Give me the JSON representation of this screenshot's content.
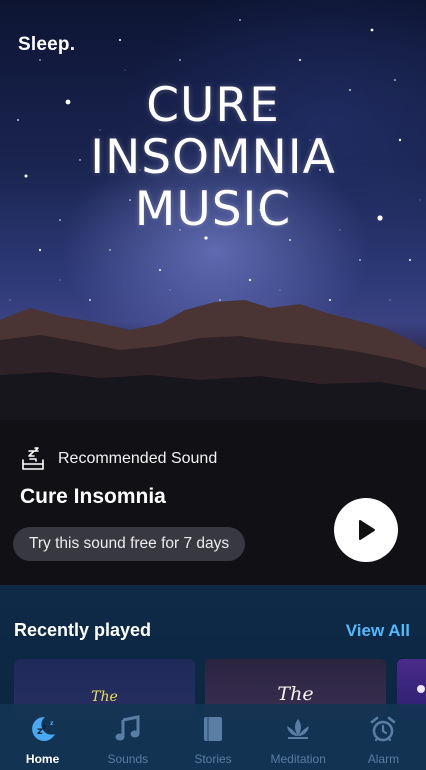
{
  "hero": {
    "brand": "Sleep.",
    "title_lines": [
      "CURE",
      "INSOMNIA",
      "MUSIC"
    ],
    "recommended_label": "Recommended Sound",
    "sound_title": "Cure Insomnia",
    "trial_text": "Try this sound free for 7 days"
  },
  "recent": {
    "header": "Recently played",
    "view_all": "View All",
    "cards": [
      {
        "text": "The"
      },
      {
        "text": "The"
      },
      {
        "text": ""
      }
    ]
  },
  "tabs": [
    {
      "label": "Home",
      "icon": "home-moon-icon",
      "active": true
    },
    {
      "label": "Sounds",
      "icon": "music-note-icon",
      "active": false
    },
    {
      "label": "Stories",
      "icon": "book-icon",
      "active": false
    },
    {
      "label": "Meditation",
      "icon": "lotus-icon",
      "active": false
    },
    {
      "label": "Alarm",
      "icon": "alarm-clock-icon",
      "active": false
    }
  ],
  "colors": {
    "accent": "#53b9ff",
    "active_tab": "#4aa8f0",
    "inactive_tab": "#5a7da3",
    "background": "#0c2238"
  }
}
